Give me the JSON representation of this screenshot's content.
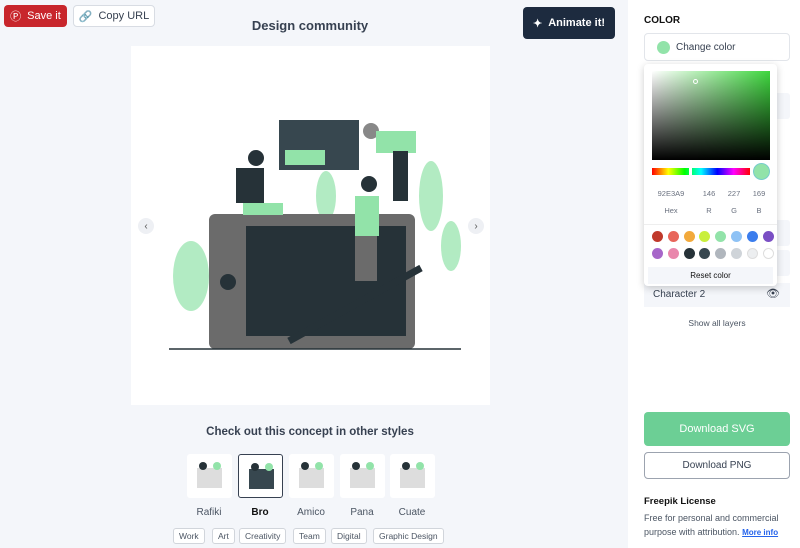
{
  "toolbar": {
    "save_label": "Save it",
    "copy_label": "Copy URL",
    "animate_label": "Animate it!"
  },
  "main": {
    "title": "Design community",
    "styles_title": "Check out this concept in other styles",
    "styles": [
      {
        "label": "Rafiki"
      },
      {
        "label": "Bro",
        "selected": true
      },
      {
        "label": "Amico"
      },
      {
        "label": "Pana"
      },
      {
        "label": "Cuate"
      }
    ],
    "tags": [
      "Work",
      "Art",
      "Creativity",
      "Team",
      "Digital",
      "Graphic Design"
    ]
  },
  "panel": {
    "color_heading": "COLOR",
    "change_color_label": "Change color",
    "picker": {
      "hex": "92E3A9",
      "r": "146",
      "g": "227",
      "b": "169",
      "hex_label": "Hex",
      "r_label": "R",
      "g_label": "G",
      "b_label": "B",
      "reset_label": "Reset color",
      "swatches": [
        "#c0392b",
        "#e8655a",
        "#f2a93b",
        "#c9ef3c",
        "#92e3a9",
        "#8ec2f5",
        "#3b7ded",
        "#7a4fc4",
        "#a766c9",
        "#e987ac",
        "#263238",
        "#37474f",
        "#b0b6bd",
        "#cfd4d9",
        "#eceef0",
        "#ffffff"
      ]
    },
    "layer_label": "Character 2",
    "show_all_label": "Show all layers",
    "download_svg": "Download SVG",
    "download_png": "Download PNG",
    "license_title": "Freepik License",
    "license_text": "Free for personal and commercial purpose with attribution.",
    "more_info": "More info"
  },
  "colors": {
    "accent": "#92e3a9",
    "save": "#c8262c",
    "animate": "#1d2b3f",
    "download": "#6ccf95"
  }
}
